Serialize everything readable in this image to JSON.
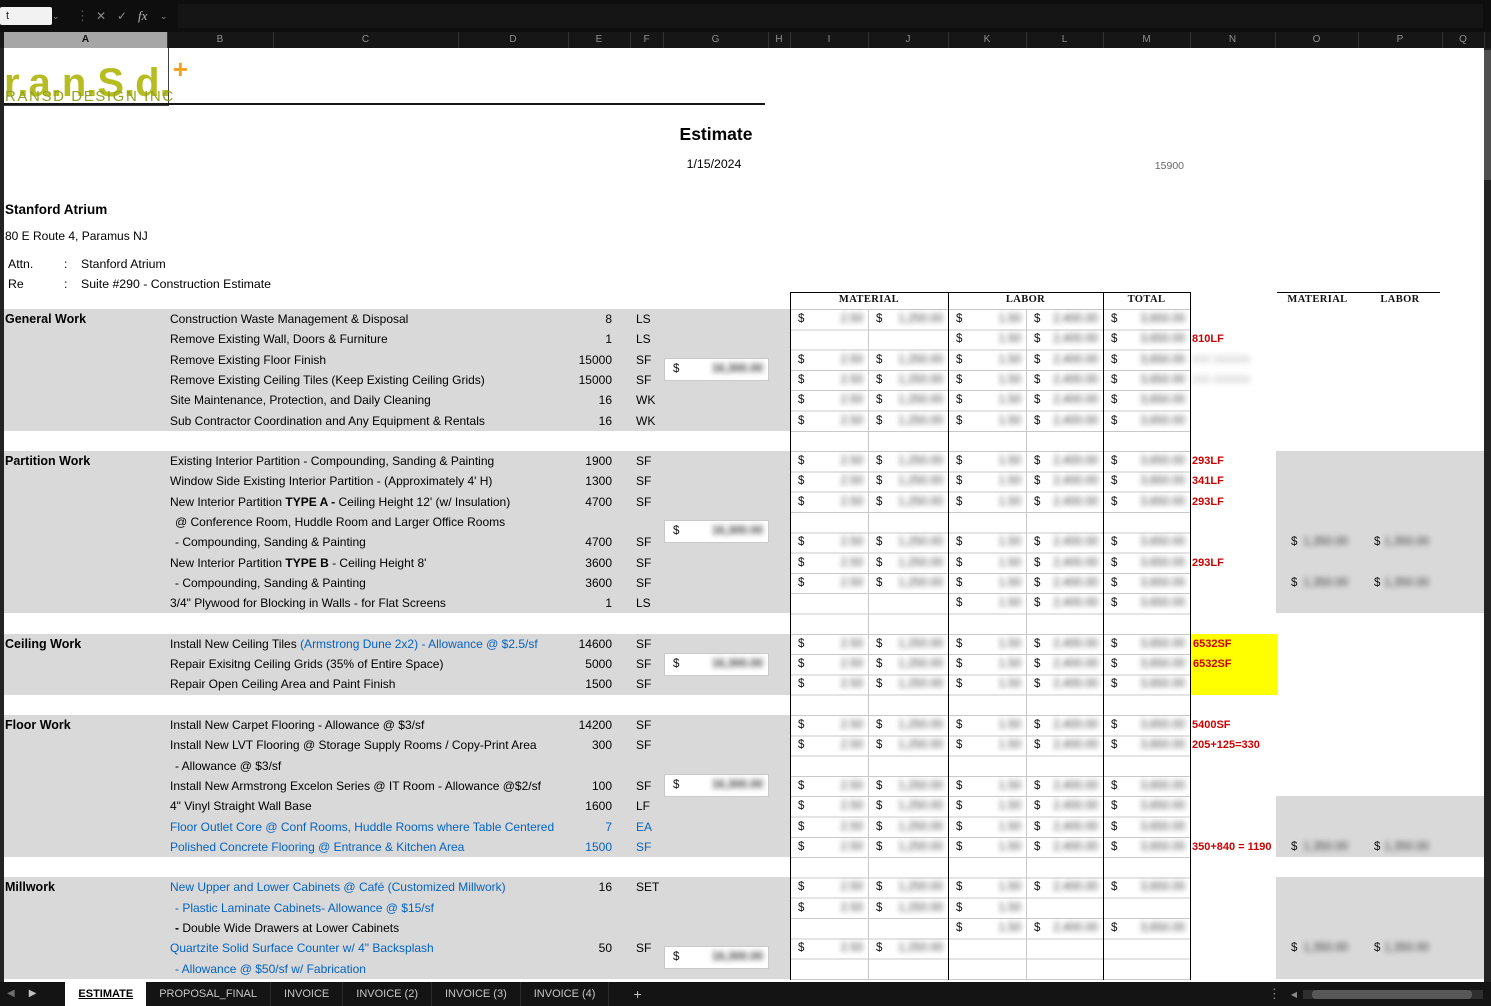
{
  "formula_bar": {
    "name_box": "t",
    "cancel_icon": "✕",
    "confirm_icon": "✓",
    "fx_label": "fx"
  },
  "icons": {
    "nav_left": "◀",
    "nav_right": "▶",
    "scroll_left": "◀",
    "menu_dots": "⋮",
    "dropdown": "⌄"
  },
  "columns": [
    "A",
    "B",
    "C",
    "D",
    "E",
    "F",
    "G",
    "H",
    "I",
    "J",
    "K",
    "L",
    "M",
    "N",
    "O",
    "P",
    "Q"
  ],
  "logo": {
    "wordmark": "r.a.n.S.d.",
    "plus": "+",
    "company": "RANSD DESIGN INC"
  },
  "doc": {
    "title": "Estimate",
    "date": "1/15/2024",
    "ref": "15900",
    "client": "Stanford Atrium",
    "address": "80 E Route 4, Paramus NJ",
    "attn_label": "Attn.",
    "attn_colon": ":",
    "attn": "Stanford Atrium",
    "re_label": "Re",
    "re_colon": ":",
    "re": "Suite #290 - Construction Estimate"
  },
  "cost_headers": {
    "material": "MATERIAL",
    "labor": "LABOR",
    "total": "TOTAL",
    "material_right": "MATERIAL",
    "labor_right": "LABOR"
  },
  "blur_placeholders": {
    "money": [
      "2.50",
      "1,250.00",
      "1.50",
      "2,400.00",
      "3,650.00"
    ],
    "subtotal": "16,300.00",
    "right": "1,350.00"
  },
  "colors": {
    "annotation_red": "#cc0000",
    "hyperlink_blue": "#0563c1",
    "highlight_yellow": "#ffff00",
    "section_gray": "#d9d9d9",
    "logo_green": "#b6bd22",
    "logo_orange": "#f5a01e"
  },
  "sections": [
    {
      "name": "General Work",
      "rows": [
        {
          "d": [
            [
              "Construction Waste Management & Disposal",
              "n"
            ]
          ],
          "q": "8",
          "u": "LS",
          "m": "11111"
        },
        {
          "d": [
            [
              "Remove Existing Wall, Doors & Furniture",
              "n"
            ]
          ],
          "q": "1",
          "u": "LS",
          "m": "00111",
          "note": {
            "t": "810LF",
            "c": "red"
          }
        },
        {
          "d": [
            [
              "Remove Existing Floor Finish",
              "n"
            ]
          ],
          "q": "15000",
          "u": "SF",
          "m": "11111",
          "note": {
            "t": "000 000000",
            "c": "blur"
          }
        },
        {
          "d": [
            [
              "Remove Existing Ceiling Tiles (Keep Existing Ceiling Grids)",
              "n"
            ]
          ],
          "q": "15000",
          "u": "SF",
          "m": "11111",
          "note": {
            "t": "000 000000",
            "c": "blur"
          }
        },
        {
          "d": [
            [
              "Site Maintenance, Protection, and Daily Cleaning",
              "n"
            ]
          ],
          "q": "16",
          "u": "WK",
          "m": "11111"
        },
        {
          "d": [
            [
              "Sub Contractor Coordination and Any Equipment & Rentals",
              "n"
            ]
          ],
          "q": "16",
          "u": "WK",
          "m": "11111"
        }
      ]
    },
    {
      "name": "Partition Work",
      "right_band": {
        "start": 0,
        "rows": 8
      },
      "rows": [
        {
          "d": [
            [
              "Existing Interior Partition - Compounding, Sanding & Painting",
              "n"
            ]
          ],
          "q": "1900",
          "u": "SF",
          "m": "11111",
          "note": {
            "t": "293LF",
            "c": "red"
          }
        },
        {
          "d": [
            [
              "Window Side Existing Interior Partition - (Approximately 4' H)",
              "n"
            ]
          ],
          "q": "1300",
          "u": "SF",
          "m": "11111",
          "note": {
            "t": "341LF",
            "c": "red"
          }
        },
        {
          "d": [
            [
              "New Interior Partition ",
              "n"
            ],
            [
              "TYPE A - ",
              "b"
            ],
            [
              "Ceiling Height 12' (w/ Insulation)",
              "n"
            ]
          ],
          "q": "4700",
          "u": "SF",
          "m": "11111",
          "note": {
            "t": "293LF",
            "c": "red"
          }
        },
        {
          "d": [
            [
              "@ Conference Room, Huddle Room and Larger Office Rooms",
              "n"
            ]
          ],
          "indent": 1,
          "m": "00000"
        },
        {
          "d": [
            [
              "- Compounding, Sanding & Painting",
              "n"
            ]
          ],
          "indent": 1,
          "q": "4700",
          "u": "SF",
          "m": "11111",
          "rm": true
        },
        {
          "d": [
            [
              "New Interior Partition ",
              "n"
            ],
            [
              "TYPE B",
              "b"
            ],
            [
              " - Ceiling Height 8'",
              "n"
            ]
          ],
          "q": "3600",
          "u": "SF",
          "m": "11111",
          "note": {
            "t": "293LF",
            "c": "red"
          }
        },
        {
          "d": [
            [
              "- Compounding, Sanding & Painting",
              "n"
            ]
          ],
          "indent": 1,
          "q": "3600",
          "u": "SF",
          "m": "11111",
          "rm": true
        },
        {
          "d": [
            [
              "3/4\" Plywood for Blocking in Walls - for Flat Screens",
              "n"
            ]
          ],
          "q": "1",
          "u": "LS",
          "m": "00111"
        }
      ]
    },
    {
      "name": "Ceiling Work",
      "rows": [
        {
          "d": [
            [
              "Install New Ceiling Tiles ",
              "n"
            ],
            [
              "(Armstrong Dune 2x2) - Allowance @ $2.5/sf",
              "u"
            ]
          ],
          "q": "14600",
          "u": "SF",
          "m": "11111",
          "note": {
            "t": "6532SF",
            "c": "red",
            "bg": "y"
          }
        },
        {
          "d": [
            [
              "Repair Exisitng Ceiling Grids (35% of Entire Space)",
              "n"
            ]
          ],
          "q": "5000",
          "u": "SF",
          "m": "11111",
          "note": {
            "t": "6532SF",
            "c": "red",
            "bg": "y"
          }
        },
        {
          "d": [
            [
              "Repair Open Ceiling Area and Paint Finish",
              "n"
            ]
          ],
          "q": "1500",
          "u": "SF",
          "m": "11111",
          "note": {
            "t": "",
            "c": "red",
            "bg": "y"
          }
        }
      ]
    },
    {
      "name": "Floor Work",
      "right_band": {
        "start": 4,
        "rows": 3
      },
      "rows": [
        {
          "d": [
            [
              "Install New Carpet Flooring - Allowance @ $3/sf",
              "n"
            ]
          ],
          "q": "14200",
          "u": "SF",
          "m": "11111",
          "note": {
            "t": "5400SF",
            "c": "red"
          }
        },
        {
          "d": [
            [
              "Install New LVT Flooring @ Storage Supply Rooms / Copy-Print Area",
              "n"
            ]
          ],
          "q": "300",
          "u": "SF",
          "m": "11111",
          "note": {
            "t": "205+125=330",
            "c": "red"
          }
        },
        {
          "d": [
            [
              " - Allowance @ $3/sf",
              "n"
            ]
          ],
          "indent": 1,
          "m": "00000"
        },
        {
          "d": [
            [
              "Install New Armstrong Excelon Series @ IT Room - Allowance @$2/sf",
              "n"
            ]
          ],
          "q": "100",
          "u": "SF",
          "m": "11111"
        },
        {
          "d": [
            [
              "4\" Vinyl Straight Wall Base",
              "n"
            ]
          ],
          "q": "1600",
          "u": "LF",
          "m": "11111"
        },
        {
          "d": [
            [
              "Floor Outlet Core @ Conf Rooms, Huddle Rooms where Table Centered",
              "u"
            ]
          ],
          "q": "7",
          "u": "EA",
          "m": "11111",
          "nb": true
        },
        {
          "d": [
            [
              "Polished Concrete Flooring @ Entrance & Kitchen Area",
              "u"
            ]
          ],
          "q": "1500",
          "u": "SF",
          "m": "11111",
          "nb": true,
          "rm": true,
          "note": {
            "t": "350+840 =  1190",
            "c": "red"
          }
        }
      ]
    },
    {
      "name": "Millwork",
      "right_band": {
        "start": 0,
        "rows": 5
      },
      "rows": [
        {
          "d": [
            [
              "New Upper and Lower Cabinets @ Café (Customized Millwork)",
              "u"
            ]
          ],
          "q": "16",
          "u": "SET",
          "m": "11111"
        },
        {
          "d": [
            [
              " - Plastic Laminate Cabinets- Allowance @ $15/sf",
              "u"
            ]
          ],
          "indent": 1,
          "m": "11100"
        },
        {
          "d": [
            [
              "- ",
              "b"
            ],
            [
              "Double Wide Drawers at Lower Cabinets",
              "n"
            ]
          ],
          "indent": 1,
          "m": "00111"
        },
        {
          "d": [
            [
              "Quartzite Solid Surface Counter w/ 4\" Backsplash",
              "u"
            ]
          ],
          "q": "50",
          "u": "SF",
          "m": "11000",
          "rm": true
        },
        {
          "d": [
            [
              " - Allowance @ $50/sf w/ Fabrication",
              "u"
            ]
          ],
          "indent": 1,
          "m": "00000"
        }
      ]
    }
  ],
  "sheet_tabs": {
    "active": "ESTIMATE",
    "tabs": [
      "ESTIMATE",
      "PROPOSAL_FINAL",
      "INVOICE",
      "INVOICE (2)",
      "INVOICE (3)",
      "INVOICE (4)"
    ],
    "add_tab": "+"
  }
}
